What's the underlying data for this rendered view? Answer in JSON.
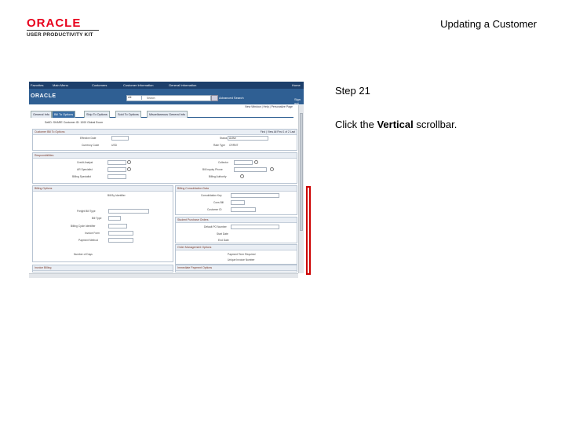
{
  "logo": {
    "brand": "ORACLE",
    "product": "USER PRODUCTIVITY KIT"
  },
  "page_title": "Updating a Customer",
  "step": {
    "label": "Step 21"
  },
  "instruction": {
    "prefix": "Click the ",
    "emphasis": "Vertical",
    "suffix": " scrollbar."
  },
  "screenshot": {
    "nav_items": [
      "Favorites",
      "Main Menu",
      "Customers",
      "Customer Information",
      "General Information"
    ],
    "home": "Home",
    "brand": "ORACLE",
    "search_scope": "All",
    "search_placeholder": "Search",
    "advanced_search": "Advanced Search",
    "sign_out": "Sign out",
    "links": "New Window | Help | Personalize Page",
    "tabs": [
      "General Info",
      "Bill To Options",
      "Ship To Options",
      "Sold To Options",
      "Miscellaneous General Info"
    ],
    "header": "SetID: SHARE     Customer ID: 1000     Global Ecom",
    "addr_section": "Customer Bill To Options",
    "find_nav": "Find | View All     First  1 of 2  Last",
    "fields": {
      "effective_date": "Effective Date",
      "status": "Status",
      "status_value": "Active",
      "currency_code": "Currency Code",
      "currency_value": "USD",
      "rate_type": "Rate Type",
      "rate_value": "CRRNT",
      "credit_analyst": "Credit Analyst",
      "collector": "Collector",
      "ar_specialist": "AR Specialist",
      "bill_inquiry": "Bill Inquiry Phone",
      "billing_specialist": "Billing Specialist",
      "billing_authority": "Billing Authority"
    },
    "responsibilities": "Responsibilities",
    "billing_options": "Billing Options",
    "billing_fields": {
      "bill_by": "Bill By Identifier",
      "freight": "Freight Bill Type",
      "bill_type": "Bill Type",
      "billing_cycle": "Billing Cycle Identifier",
      "invoice_form": "Invoice Form",
      "payment_method": "Payment Method",
      "number_of_days": "Number of Days"
    },
    "consolidation": "Billing Consolidation Data",
    "consolidation_fields": [
      "Consolidation Key",
      "Cons Bill",
      "Customer ID"
    ],
    "purchase_orders": "Student Purchase Orders",
    "po_fields": [
      "Default PO Number",
      "Start Date",
      "End Date"
    ],
    "ordermgmt": "Order Management Options",
    "ordermgmt_fields": [
      "Payment Term Required",
      "Unique Invoice Number"
    ],
    "bottom_left": "Invoice Billing",
    "bottom_right": "Immediate Payment Options"
  },
  "colors": {
    "highlight": "#cc0000",
    "nav": "#1d3f6b",
    "brandbar": "#2f5f93"
  }
}
